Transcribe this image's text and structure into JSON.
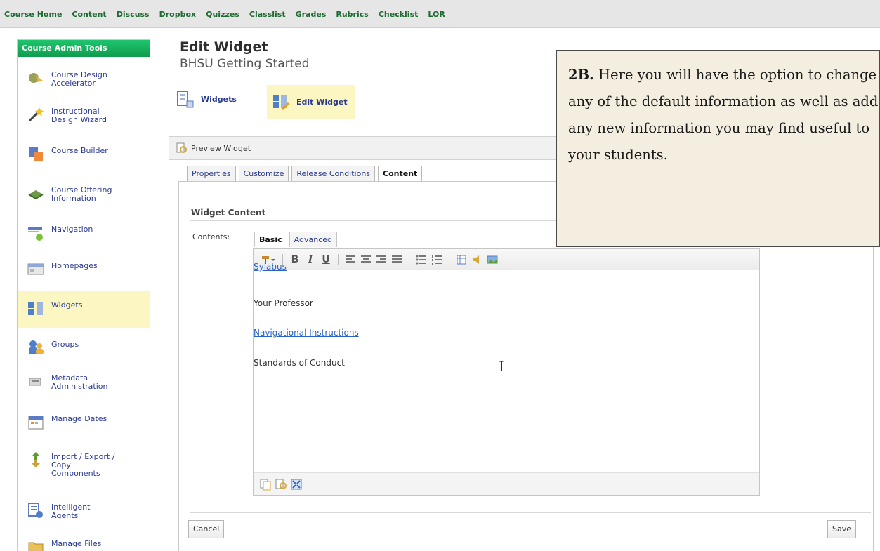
{
  "topnav": [
    "Course Home",
    "Content",
    "Discuss",
    "Dropbox",
    "Quizzes",
    "Classlist",
    "Grades",
    "Rubrics",
    "Checklist",
    "LOR"
  ],
  "sidebar": {
    "title": "Course Admin Tools",
    "items": [
      {
        "label": "Course Design\nAccelerator"
      },
      {
        "label": "Instructional\nDesign Wizard"
      },
      {
        "label": "Course Builder"
      },
      {
        "label": "Course Offering\nInformation"
      },
      {
        "label": "Navigation"
      },
      {
        "label": "Homepages"
      },
      {
        "label": "Widgets"
      },
      {
        "label": "Groups"
      },
      {
        "label": "Metadata\nAdministration"
      },
      {
        "label": "Manage Dates"
      },
      {
        "label": "Import / Export /\nCopy\nComponents"
      },
      {
        "label": "Intelligent\nAgents"
      },
      {
        "label": "Manage Files"
      }
    ]
  },
  "page": {
    "title": "Edit Widget",
    "subtitle": "BHSU Getting Started"
  },
  "breadcrumbs": [
    {
      "label": "Widgets"
    },
    {
      "label": "Edit Widget"
    }
  ],
  "preview": {
    "label": "Preview Widget"
  },
  "tabs": [
    "Properties",
    "Customize",
    "Release Conditions",
    "Content"
  ],
  "section": {
    "heading": "Widget Content",
    "contents_label": "Contents:"
  },
  "editor_tabs": [
    "Basic",
    "Advanced"
  ],
  "editor": {
    "toolbar": {
      "bold": "B",
      "italic": "I",
      "underline": "U"
    },
    "lines": [
      "Sylabus",
      "Your Professor",
      "Navigational Instructions",
      "Standards of Conduct"
    ]
  },
  "buttons": {
    "cancel": "Cancel",
    "save": "Save"
  },
  "callout": {
    "lead": "2B.",
    "text": " Here you will have the option to change any of the default information as well as add any new information you may find useful to your students."
  }
}
